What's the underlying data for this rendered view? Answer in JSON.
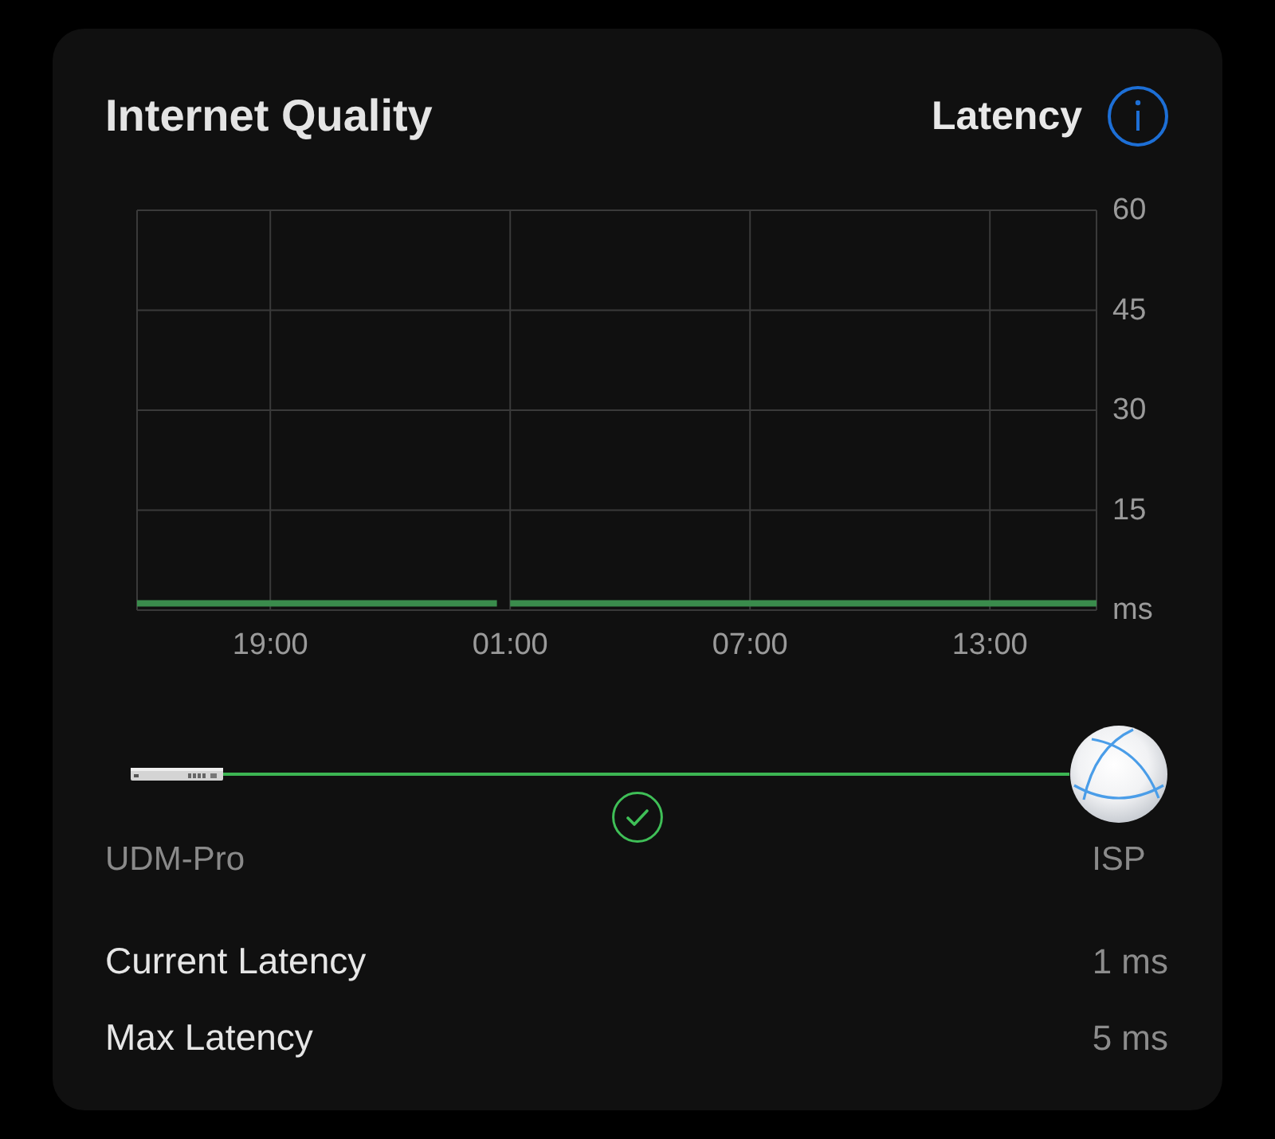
{
  "card": {
    "title": "Internet Quality",
    "metric": "Latency"
  },
  "chart": {
    "chart_data": {
      "type": "line",
      "grid": true,
      "categories": [
        null,
        null,
        null,
        null,
        null,
        null,
        null,
        null,
        null,
        null,
        null,
        null,
        null,
        null,
        null,
        null,
        null,
        null,
        null,
        null,
        "19:00",
        null,
        null,
        null,
        null,
        null,
        null,
        null,
        null,
        null,
        null,
        null,
        null,
        null,
        null,
        null,
        null,
        null,
        null,
        null,
        null,
        null,
        null,
        null,
        null,
        null,
        null,
        null,
        null,
        null,
        null,
        null,
        null,
        null,
        null,
        null,
        "01:00",
        null,
        null,
        null,
        null,
        null,
        null,
        null,
        null,
        null,
        null,
        null,
        null,
        null,
        null,
        null,
        null,
        null,
        null,
        null,
        null,
        null,
        null,
        null,
        null,
        null,
        null,
        null,
        null,
        null,
        null,
        null,
        null,
        null,
        null,
        null,
        "07:00",
        null,
        null,
        null,
        null,
        null,
        null,
        null,
        null,
        null,
        null,
        null,
        null,
        null,
        null,
        null,
        null,
        null,
        null,
        null,
        null,
        null,
        null,
        null,
        null,
        null,
        null,
        null,
        null,
        null,
        null,
        null,
        null,
        null,
        null,
        null,
        "13:00",
        null,
        null,
        null,
        null,
        null,
        null,
        null,
        null,
        null,
        null,
        null,
        null,
        null,
        null,
        null,
        null
      ],
      "series": [
        {
          "color": "#3a8c4c",
          "values": [
            1,
            1,
            1,
            1,
            1,
            1,
            1,
            1,
            1,
            1,
            1,
            1,
            1,
            1,
            1,
            1,
            1,
            1,
            1,
            1,
            1,
            1,
            1,
            1,
            1,
            1,
            1,
            1,
            1,
            1,
            1,
            1,
            1,
            1,
            1,
            1,
            1,
            1,
            1,
            1,
            1,
            1,
            1,
            1,
            1,
            1,
            1,
            1,
            1,
            1,
            1,
            1,
            1,
            1,
            1,
            null,
            1,
            1,
            1,
            1,
            1,
            1,
            1,
            1,
            1,
            1,
            1,
            1,
            1,
            1,
            1,
            1,
            1,
            1,
            1,
            1,
            1,
            1,
            1,
            1,
            1,
            1,
            1,
            1,
            1,
            1,
            1,
            1,
            1,
            1,
            1,
            1,
            1,
            1,
            1,
            1,
            1,
            1,
            1,
            1,
            1,
            1,
            1,
            1,
            1,
            1,
            1,
            1,
            1,
            1,
            1,
            1,
            1,
            1,
            1,
            1,
            1,
            1,
            1,
            1,
            1,
            1,
            1,
            1,
            1,
            1,
            1,
            1,
            1,
            1,
            1,
            1,
            1,
            1,
            1,
            1,
            1,
            1,
            1,
            1,
            1,
            1,
            1,
            1,
            1
          ]
        }
      ],
      "ylim": [
        0,
        60
      ],
      "yticks": [
        {
          "value": 0,
          "label": "ms"
        },
        {
          "value": 15,
          "label": "15"
        },
        {
          "value": 30,
          "label": "30"
        },
        {
          "value": 45,
          "label": "45"
        },
        {
          "value": 60,
          "label": "60"
        }
      ]
    }
  },
  "connection": {
    "from": "UDM-Pro",
    "to": "ISP",
    "healthy": true
  },
  "stats": [
    {
      "label": "Current Latency",
      "value": "1 ms"
    },
    {
      "label": "Max Latency",
      "value": "5 ms"
    }
  ]
}
